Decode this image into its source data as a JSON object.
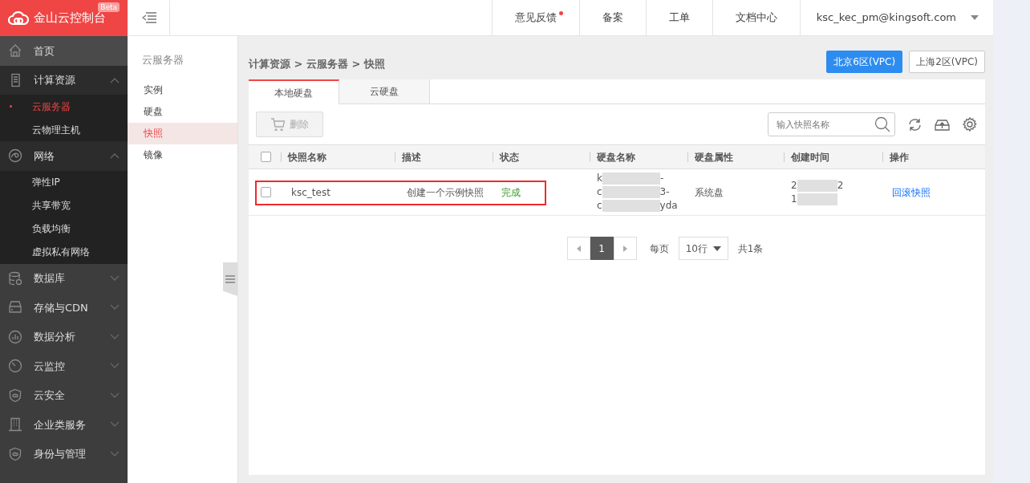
{
  "brand": {
    "title": "金山云控制台",
    "badge": "Beta"
  },
  "topbar": {
    "links": [
      {
        "label": "意见反馈",
        "dot": true
      },
      {
        "label": "备案",
        "dot": false
      },
      {
        "label": "工单",
        "dot": false
      },
      {
        "label": "文档中心",
        "dot": false
      }
    ],
    "user": "ksc_kec_pm@kingsoft.com"
  },
  "sidebar": {
    "items": [
      {
        "label": "首页",
        "expanded": false,
        "selected": false
      },
      {
        "label": "计算资源",
        "expanded": true,
        "selected": false,
        "children": [
          {
            "label": "云服务器",
            "selected": true
          },
          {
            "label": "云物理主机",
            "selected": false
          }
        ]
      },
      {
        "label": "网络",
        "expanded": true,
        "selected": false,
        "children": [
          {
            "label": "弹性IP",
            "selected": false
          },
          {
            "label": "共享带宽",
            "selected": false
          },
          {
            "label": "负载均衡",
            "selected": false
          },
          {
            "label": "虚拟私有网络",
            "selected": false
          }
        ]
      },
      {
        "label": "数据库",
        "expanded": false,
        "selected": false
      },
      {
        "label": "存储与CDN",
        "expanded": false,
        "selected": false
      },
      {
        "label": "数据分析",
        "expanded": false,
        "selected": false
      },
      {
        "label": "云监控",
        "expanded": false,
        "selected": false
      },
      {
        "label": "云安全",
        "expanded": false,
        "selected": false
      },
      {
        "label": "企业类服务",
        "expanded": false,
        "selected": false
      },
      {
        "label": "身份与管理",
        "expanded": false,
        "selected": false
      }
    ]
  },
  "subnav": {
    "title": "云服务器",
    "items": [
      {
        "label": "实例",
        "selected": false
      },
      {
        "label": "硬盘",
        "selected": false
      },
      {
        "label": "快照",
        "selected": true
      },
      {
        "label": "镜像",
        "selected": false
      }
    ]
  },
  "breadcrumb": "计算资源 > 云服务器 > 快照",
  "regions": [
    {
      "label": "北京6区(VPC)",
      "selected": true
    },
    {
      "label": "上海2区(VPC)",
      "selected": false
    }
  ],
  "tabs": [
    {
      "label": "本地硬盘",
      "selected": true
    },
    {
      "label": "云硬盘",
      "selected": false
    }
  ],
  "toolbar": {
    "delete_button": {
      "label": "删除",
      "disabled": true
    },
    "search": {
      "placeholder": "输入快照名称"
    }
  },
  "table": {
    "select_all_checked": false,
    "columns": [
      "快照名称",
      "描述",
      "状态",
      "硬盘名称",
      "硬盘属性",
      "创建时间",
      "操作"
    ],
    "rows": [
      {
        "checked": false,
        "highlighted": true,
        "name": "ksc_test",
        "description": "创建一个示例快照",
        "status": "完成",
        "disk_name": [
          {
            "start": "k",
            "end": "-"
          },
          {
            "start": "c",
            "end": "3-"
          },
          {
            "start": "c",
            "end": "yda"
          }
        ],
        "disk_type": "系统盘",
        "created": [
          {
            "start": "2",
            "end": "2"
          },
          {
            "start": "1"
          }
        ],
        "action": "回滚快照"
      }
    ]
  },
  "pagination": {
    "current": "1",
    "per_page_label": "每页",
    "per_page": "10行",
    "total": "共1条"
  }
}
